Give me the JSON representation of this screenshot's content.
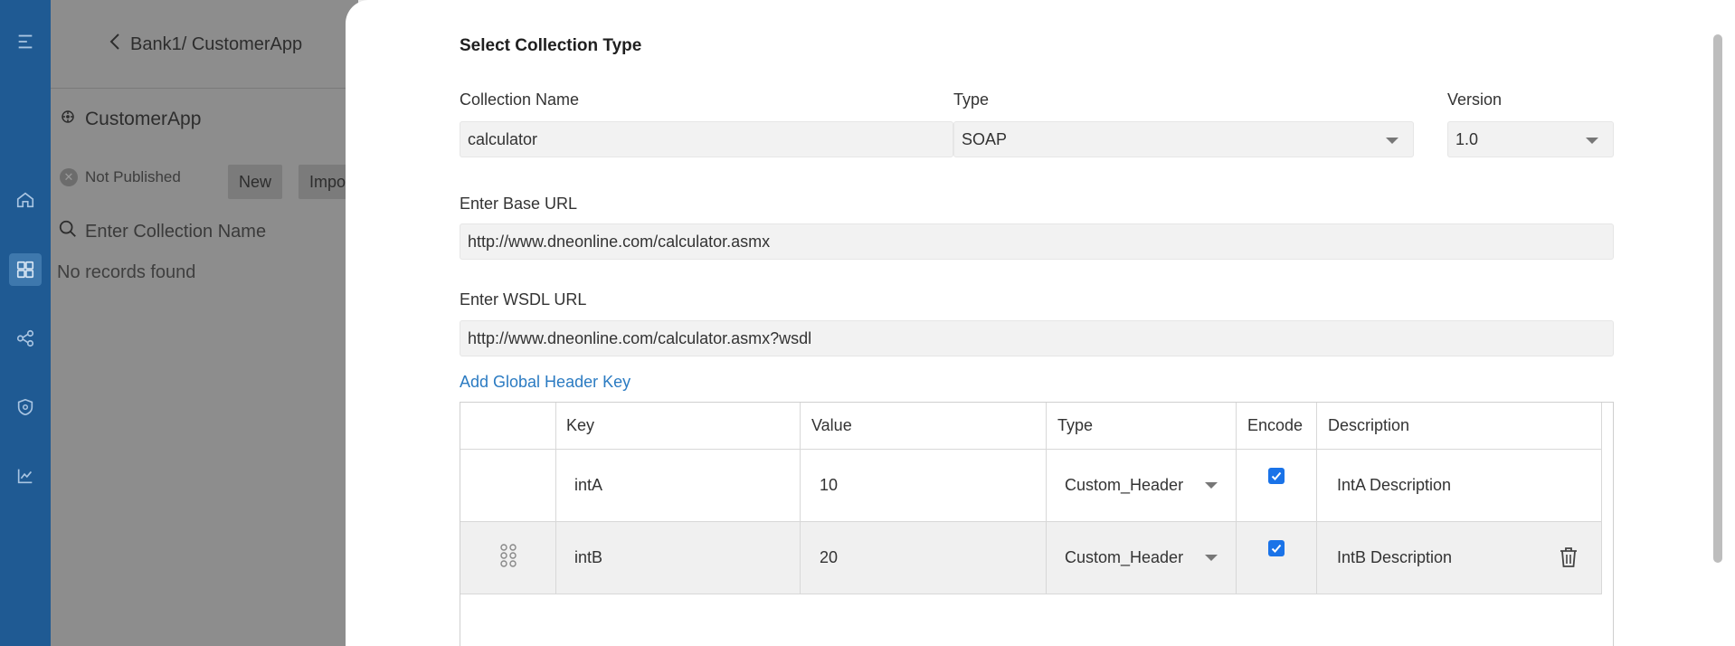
{
  "rail": {
    "icons": [
      "hamburger-icon",
      "home-icon",
      "dashboard-icon",
      "share-icon",
      "shield-icon",
      "chart-icon"
    ]
  },
  "background": {
    "breadcrumb": "Bank1/ CustomerApp",
    "app_title": "CustomerApp",
    "status": "Not Published",
    "new_button": "New",
    "import_button": "Impo",
    "search_placeholder": "Enter Collection Name",
    "empty_text": "No records found"
  },
  "form": {
    "title": "Select Collection Type",
    "collection_name_label": "Collection Name",
    "collection_name_value": "calculator",
    "type_label": "Type",
    "type_value": "SOAP",
    "version_label": "Version",
    "version_value": "1.0",
    "base_url_label": "Enter Base URL",
    "base_url_value": "http://www.dneonline.com/calculator.asmx",
    "wsdl_url_label": "Enter WSDL URL",
    "wsdl_url_value": "http://www.dneonline.com/calculator.asmx?wsdl",
    "add_header_link": "Add Global Header Key"
  },
  "headers_table": {
    "columns": [
      "Key",
      "Value",
      "Type",
      "Encode",
      "Description"
    ],
    "rows": [
      {
        "key": "intA",
        "value": "10",
        "type": "Custom_Header",
        "encode": true,
        "description": "IntA Description"
      },
      {
        "key": "intB",
        "value": "20",
        "type": "Custom_Header",
        "encode": true,
        "description": "IntB Description"
      }
    ]
  },
  "colors": {
    "rail": "#1f5a93",
    "link": "#2b7bc2",
    "checkbox": "#1a73e8"
  }
}
